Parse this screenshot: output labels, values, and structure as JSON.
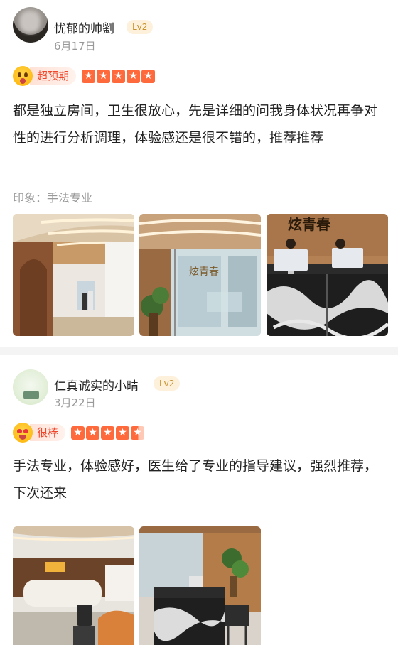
{
  "reviews": [
    {
      "username": "忧郁的帅劉",
      "level": "Lv2",
      "date": "6月17日",
      "rating_label": "超预期",
      "rating_emoji": "surprised-face-icon",
      "stars": 5,
      "text": "都是独立房间，卫生很放心，先是详细的问我身体状况再争对性的进行分析调理，体验感还是很不错的，推荐推荐",
      "impression": "印象：手法专业",
      "photo_count": 3
    },
    {
      "username": "仁真诚实的小晴",
      "level": "Lv2",
      "date": "3月22日",
      "rating_label": "很棒",
      "rating_emoji": "heart-eyes-face-icon",
      "stars": 4.5,
      "text": "手法专业，体验感好，医生给了专业的指导建议，强烈推荐，下次还来",
      "photo_count": 2
    }
  ],
  "photo_sign_text": "炫青春",
  "colors": {
    "accent": "#ff6a3d",
    "rating_text": "#f0472b",
    "level_text": "#c8922a",
    "muted": "#999999"
  }
}
